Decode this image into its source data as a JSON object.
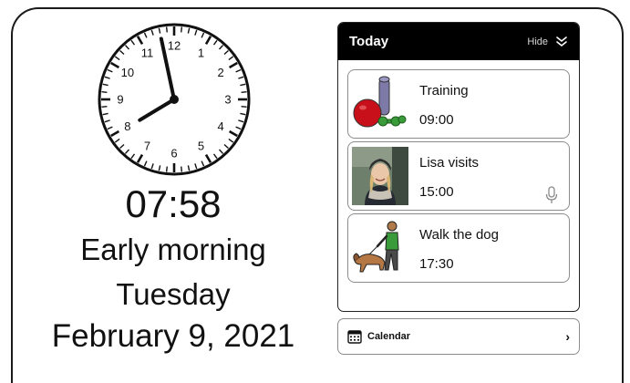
{
  "clock": {
    "numerals": [
      "12",
      "1",
      "2",
      "3",
      "4",
      "5",
      "6",
      "7",
      "8",
      "9",
      "10",
      "11"
    ],
    "hours": 7,
    "minutes": 58
  },
  "time_display": {
    "digital": "07:58",
    "period": "Early morning",
    "weekday": "Tuesday",
    "date": "February 9, 2021"
  },
  "today": {
    "title": "Today",
    "hide_label": "Hide",
    "events": [
      {
        "title": "Training",
        "time": "09:00",
        "icon": "training-equipment-icon"
      },
      {
        "title": "Lisa visits",
        "time": "15:00",
        "icon": "person-photo",
        "has_audio": true
      },
      {
        "title": "Walk the dog",
        "time": "17:30",
        "icon": "dog-walking-icon"
      }
    ]
  },
  "calendar": {
    "label": "Calendar",
    "chevron": "›"
  },
  "colors": {
    "header_bg": "#000000",
    "ball_red": "#c8101a",
    "dumbbell_green": "#3a9b3a",
    "mat_purple": "#7d7aa8"
  }
}
